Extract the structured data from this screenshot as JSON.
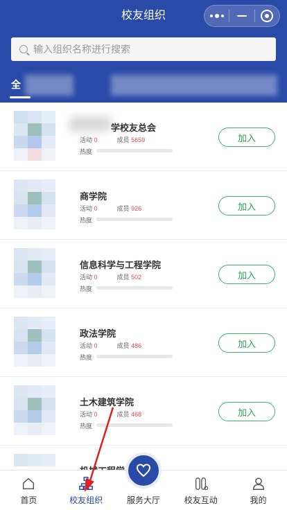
{
  "header": {
    "title": "校友组织"
  },
  "search": {
    "placeholder": "输入组织名称进行搜索"
  },
  "tabs": {
    "active_label": "全"
  },
  "list": {
    "activity_label": "活动",
    "members_label": "成员",
    "heat_label": "热度",
    "join_label": "加入",
    "items": [
      {
        "name": "学校友总会",
        "activity": "0",
        "members": "5659"
      },
      {
        "name": "商学院",
        "activity": "0",
        "members": "926"
      },
      {
        "name": "信息科学与工程学院",
        "activity": "0",
        "members": "502"
      },
      {
        "name": "政法学院",
        "activity": "0",
        "members": "486"
      },
      {
        "name": "土木建筑学院",
        "activity": "0",
        "members": "468"
      },
      {
        "name": "机械工程学",
        "activity": "",
        "members": ""
      }
    ]
  },
  "tabbar": {
    "items": [
      {
        "label": "首页",
        "icon": "home-icon"
      },
      {
        "label": "校友组织",
        "icon": "org-chart-icon"
      },
      {
        "label": "服务大厅",
        "icon": "heart-icon"
      },
      {
        "label": "校友互动",
        "icon": "interaction-icon"
      },
      {
        "label": "我的",
        "icon": "profile-icon"
      }
    ]
  },
  "colors": {
    "brand": "#2a4aa8",
    "join_green": "#3cb371",
    "count_red": "#e14b4b"
  }
}
